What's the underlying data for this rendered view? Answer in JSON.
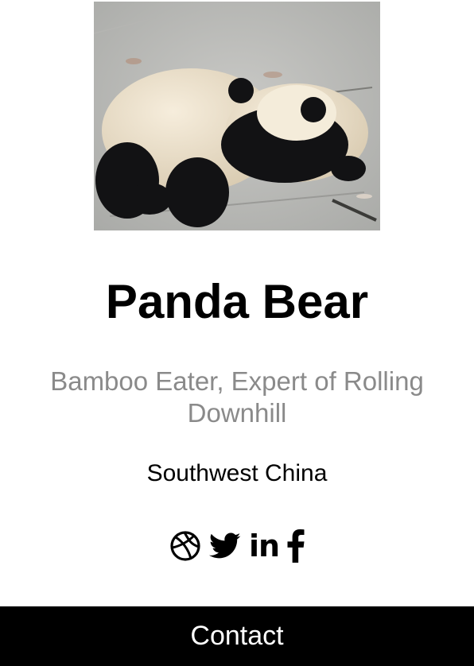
{
  "profile": {
    "name": "Panda Bear",
    "title": "Bamboo Eater, Expert of Rolling Downhill",
    "location": "Southwest China"
  },
  "social": [
    {
      "icon": "dribbble-icon"
    },
    {
      "icon": "twitter-icon"
    },
    {
      "icon": "linkedin-icon",
      "glyph": "in"
    },
    {
      "icon": "facebook-icon"
    }
  ],
  "contact": {
    "label": "Contact"
  },
  "colors": {
    "title_gray": "#8a8a8a",
    "button_bg": "#000000",
    "button_text": "#ffffff"
  }
}
